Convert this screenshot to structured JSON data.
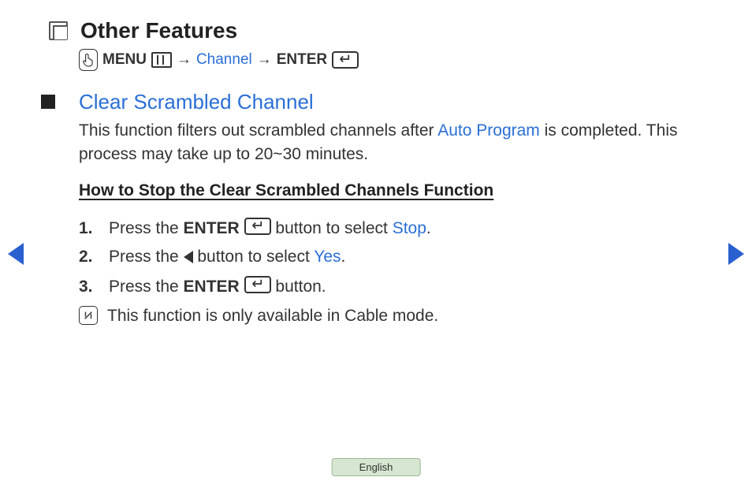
{
  "title": "Other Features",
  "breadcrumb": {
    "menu_label": "MENU",
    "channel_label": "Channel",
    "enter_label": "ENTER",
    "arrow": "→"
  },
  "section": {
    "heading": "Clear Scrambled Channel",
    "desc_pre": "This function filters out scrambled channels after ",
    "desc_link": "Auto Program",
    "desc_post": " is completed. This process may take up to 20~30 minutes.",
    "subheading": "How to Stop the Clear Scrambled Channels Function",
    "steps": [
      {
        "num": "1.",
        "pre": "Press the ",
        "bold": "ENTER",
        "mid": " button to select ",
        "link": "Stop",
        "post": "."
      },
      {
        "num": "2.",
        "pre": "Press the ",
        "mid": " button to select ",
        "link": "Yes",
        "post": "."
      },
      {
        "num": "3.",
        "pre": "Press the ",
        "bold": "ENTER",
        "post": " button."
      }
    ],
    "note_pre": "This function is only available in ",
    "note_link": "Cable",
    "note_post": " mode."
  },
  "language": "English"
}
